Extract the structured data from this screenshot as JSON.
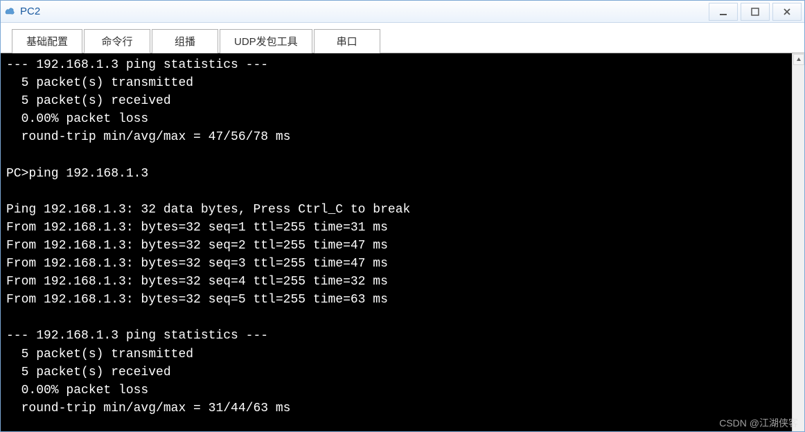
{
  "window": {
    "title": "PC2"
  },
  "tabs": [
    {
      "label": "基础配置"
    },
    {
      "label": "命令行"
    },
    {
      "label": "组播"
    },
    {
      "label": "UDP发包工具"
    },
    {
      "label": "串口"
    }
  ],
  "terminal": {
    "lines": [
      "--- 192.168.1.3 ping statistics ---",
      "  5 packet(s) transmitted",
      "  5 packet(s) received",
      "  0.00% packet loss",
      "  round-trip min/avg/max = 47/56/78 ms",
      "",
      "PC>ping 192.168.1.3",
      "",
      "Ping 192.168.1.3: 32 data bytes, Press Ctrl_C to break",
      "From 192.168.1.3: bytes=32 seq=1 ttl=255 time=31 ms",
      "From 192.168.1.3: bytes=32 seq=2 ttl=255 time=47 ms",
      "From 192.168.1.3: bytes=32 seq=3 ttl=255 time=47 ms",
      "From 192.168.1.3: bytes=32 seq=4 ttl=255 time=32 ms",
      "From 192.168.1.3: bytes=32 seq=5 ttl=255 time=63 ms",
      "",
      "--- 192.168.1.3 ping statistics ---",
      "  5 packet(s) transmitted",
      "  5 packet(s) received",
      "  0.00% packet loss",
      "  round-trip min/avg/max = 31/44/63 ms"
    ]
  },
  "watermark": "CSDN @江湖侠客"
}
